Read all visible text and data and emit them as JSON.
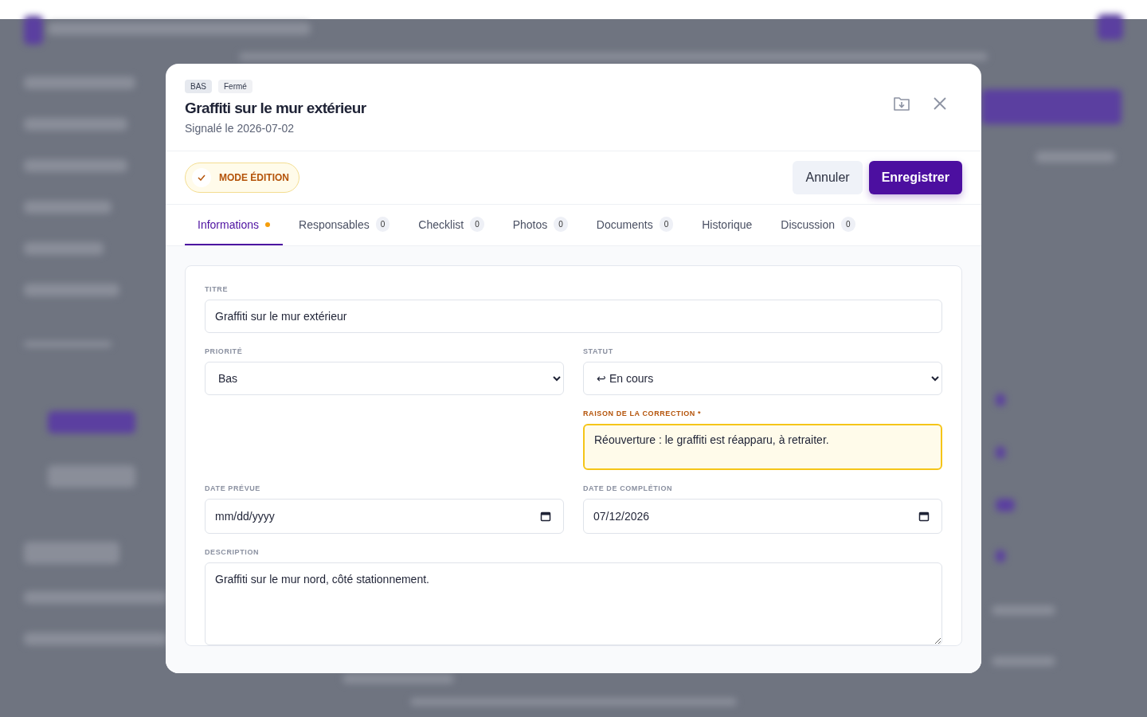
{
  "modal": {
    "badges": [
      {
        "text": "BAS",
        "kind": "priority"
      },
      {
        "text": "Fermé",
        "kind": "status"
      }
    ],
    "title": "Graffiti sur le mur extérieur",
    "subtitle": "Signalé le 2026-07-02",
    "edit_mode": {
      "label": "MODE ÉDITION",
      "on": true
    },
    "buttons": [
      {
        "label": "Annuler",
        "kind": "secondary"
      },
      {
        "label": "Enregistrer",
        "kind": "primary"
      }
    ],
    "tabs": [
      {
        "label": "Informations",
        "selected": true,
        "modified": true
      },
      {
        "label": "Responsables",
        "count": "0",
        "selected": false,
        "modified": false
      },
      {
        "label": "Checklist",
        "count": "0",
        "selected": false,
        "modified": false
      },
      {
        "label": "Photos",
        "count": "0",
        "selected": false,
        "modified": false
      },
      {
        "label": "Documents",
        "count": "0",
        "selected": false,
        "modified": false
      },
      {
        "label": "Historique",
        "selected": false,
        "modified": false
      },
      {
        "label": "Discussion",
        "count": "0",
        "selected": false,
        "modified": false
      }
    ],
    "form": {
      "fields": [
        {
          "label": "TITRE",
          "kind": "text",
          "value": "Graffiti sur le mur extérieur"
        },
        {
          "label": "PRIORITÉ",
          "kind": "select",
          "value": "Bas"
        },
        {
          "label": "STATUT",
          "kind": "select",
          "value": "↩ En cours"
        },
        {
          "kind": "spacer"
        },
        {
          "label": "RAISON DE LA CORRECTION *",
          "kind": "textarea",
          "value": "Réouverture : le graffiti est réapparu, à retraiter.",
          "highlighted": true
        },
        {
          "label": "DATE PRÉVUE",
          "kind": "date",
          "placeholder": "mm/dd/yyyy"
        },
        {
          "label": "DATE DE COMPLÉTION",
          "kind": "date",
          "value": "07/12/2026"
        },
        {
          "label": "DESCRIPTION",
          "kind": "longtext",
          "value": "Graffiti sur le mur nord, côté stationnement."
        }
      ]
    }
  }
}
